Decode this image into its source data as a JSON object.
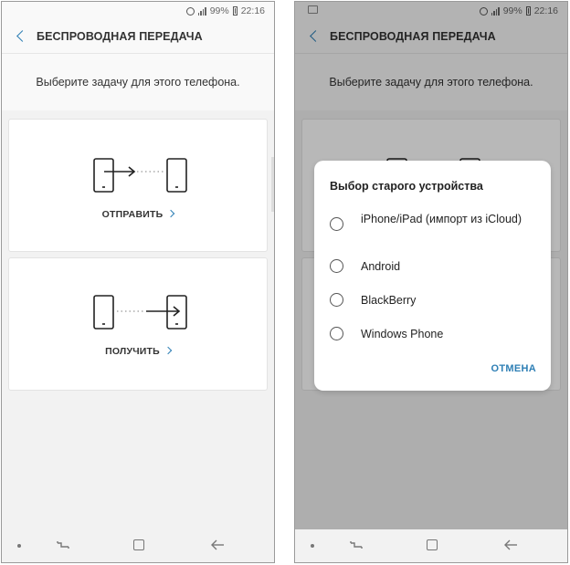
{
  "status": {
    "battery": "99%",
    "time": "22:16"
  },
  "header": {
    "title": "БЕСПРОВОДНАЯ ПЕРЕДАЧА"
  },
  "main": {
    "prompt": "Выберите задачу для этого телефона.",
    "send_label": "ОТПРАВИТЬ",
    "receive_label": "ПОЛУЧИТЬ"
  },
  "dialog": {
    "title": "Выбор старого устройства",
    "options": [
      {
        "label": "iPhone/iPad (импорт из iCloud)"
      },
      {
        "label": "Android"
      },
      {
        "label": "BlackBerry"
      },
      {
        "label": "Windows Phone"
      }
    ],
    "cancel_label": "ОТМЕНА"
  },
  "colors": {
    "accent": "#2e7fb5",
    "background": "#f2f2f2",
    "card": "#ffffff"
  },
  "icons": [
    "back-icon",
    "chevron-right-icon",
    "phone-icon",
    "arrow-icon",
    "radio-icon",
    "recent-apps-icon",
    "home-icon",
    "back-nav-icon",
    "alarm-icon",
    "signal-icon",
    "battery-icon",
    "image-icon"
  ]
}
